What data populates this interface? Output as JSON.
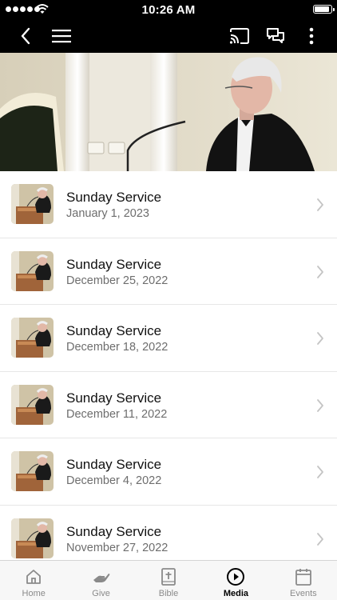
{
  "status_bar": {
    "time": "10:26 AM"
  },
  "nav": {
    "icons": [
      "back-arrow-icon",
      "hamburger-menu-icon",
      "cast-icon",
      "chat-bubbles-icon",
      "more-vertical-icon"
    ]
  },
  "sermons": [
    {
      "title": "Sunday Service",
      "date": "January 1, 2023"
    },
    {
      "title": "Sunday Service",
      "date": "December 25, 2022"
    },
    {
      "title": "Sunday Service",
      "date": "December 18, 2022"
    },
    {
      "title": "Sunday Service",
      "date": "December 11, 2022"
    },
    {
      "title": "Sunday Service",
      "date": "December 4, 2022"
    },
    {
      "title": "Sunday Service",
      "date": "November 27, 2022"
    }
  ],
  "tabs": [
    {
      "label": "Home",
      "icon": "home-icon",
      "active": false
    },
    {
      "label": "Give",
      "icon": "giving-hand-icon",
      "active": false
    },
    {
      "label": "Bible",
      "icon": "bible-icon",
      "active": false
    },
    {
      "label": "Media",
      "icon": "play-circle-icon",
      "active": true
    },
    {
      "label": "Events",
      "icon": "calendar-icon",
      "active": false
    }
  ],
  "colors": {
    "bar": "#000000",
    "active_tab": "#000000",
    "inactive_tab": "#8a8a8a"
  }
}
